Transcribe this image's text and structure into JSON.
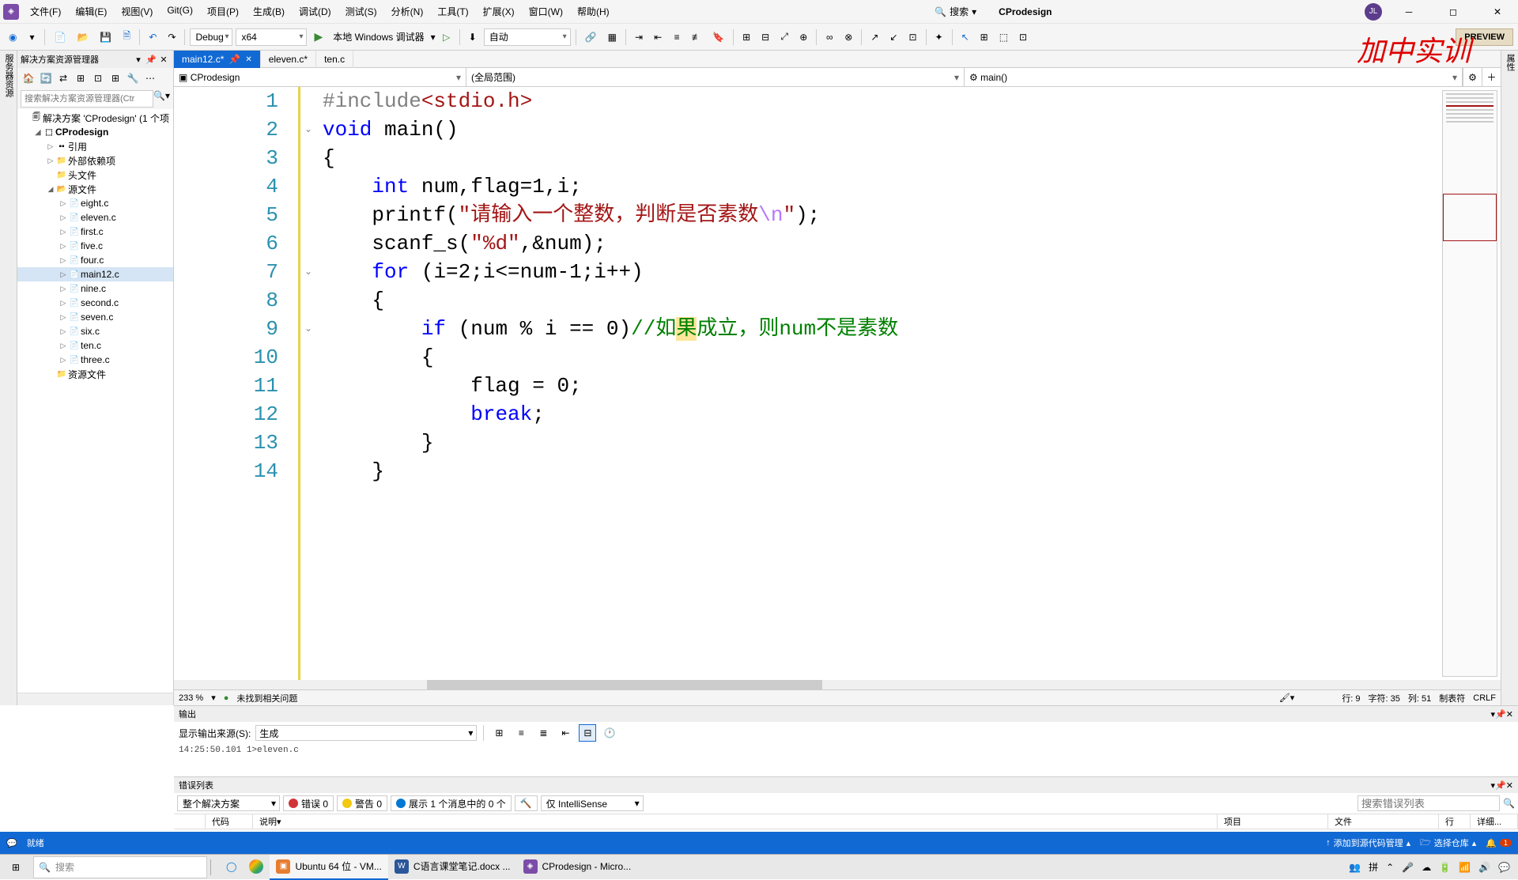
{
  "titlebar": {
    "menus": [
      "文件(F)",
      "编辑(E)",
      "视图(V)",
      "Git(G)",
      "项目(P)",
      "生成(B)",
      "调试(D)",
      "测试(S)",
      "分析(N)",
      "工具(T)",
      "扩展(X)",
      "窗口(W)",
      "帮助(H)"
    ],
    "search_label": "搜索",
    "app_title": "CProdesign",
    "user_initials": "JL"
  },
  "toolbar": {
    "config": "Debug",
    "platform": "x64",
    "debugger": "本地 Windows 调试器",
    "step_mode": "自动",
    "preview": "PREVIEW"
  },
  "watermark": "加中实训",
  "solution": {
    "title": "解决方案资源管理器",
    "search_placeholder": "搜索解决方案资源管理器(Ctr",
    "root": "解决方案 'CProdesign' (1 个项",
    "project": "CProdesign",
    "refs": "引用",
    "ext_deps": "外部依赖项",
    "headers": "头文件",
    "sources": "源文件",
    "resources": "资源文件",
    "files": [
      "eight.c",
      "eleven.c",
      "first.c",
      "five.c",
      "four.c",
      "main12.c",
      "nine.c",
      "second.c",
      "seven.c",
      "six.c",
      "ten.c",
      "three.c"
    ]
  },
  "tabs": [
    {
      "label": "main12.c*",
      "active": true,
      "pinned": true
    },
    {
      "label": "eleven.c*",
      "active": false
    },
    {
      "label": "ten.c",
      "active": false
    }
  ],
  "nav": {
    "left_icon": "▣",
    "left": "CProdesign",
    "mid": "(全局范围)",
    "right_icon": "⚙",
    "right": "main()"
  },
  "code": {
    "lines": [
      {
        "n": 1,
        "text": "#include<stdio.h>"
      },
      {
        "n": 2,
        "text": "void main()"
      },
      {
        "n": 3,
        "text": "{"
      },
      {
        "n": 4,
        "text": "    int num,flag=1,i;"
      },
      {
        "n": 5,
        "text": "    printf(\"请输入一个整数，判断是否素数\\n\");"
      },
      {
        "n": 6,
        "text": "    scanf_s(\"%d\",&num);"
      },
      {
        "n": 7,
        "text": "    for (i=2;i<=num-1;i++)"
      },
      {
        "n": 8,
        "text": "    {"
      },
      {
        "n": 9,
        "text": "        if (num % i == 0)//如果成立，则num不是素数"
      },
      {
        "n": 10,
        "text": "        {"
      },
      {
        "n": 11,
        "text": "            flag = 0;"
      },
      {
        "n": 12,
        "text": "            break;"
      },
      {
        "n": 13,
        "text": "        }"
      },
      {
        "n": 14,
        "text": "    }"
      }
    ]
  },
  "code_status": {
    "zoom": "233 %",
    "issues": "未找到相关问题",
    "line": "行: 9",
    "chars": "字符: 35",
    "col": "列: 51",
    "tabs": "制表符",
    "eol": "CRLF"
  },
  "output": {
    "title": "输出",
    "source_label": "显示输出来源(S):",
    "source_value": "生成",
    "body": "14:25:50.101   1>eleven.c"
  },
  "errors": {
    "title": "错误列表",
    "scope": "整个解决方案",
    "err_label": "错误 0",
    "warn_label": "警告 0",
    "msg_label": "展示 1 个消息中的 0 个",
    "intellisense": "仅 IntelliSense",
    "search_placeholder": "搜索错误列表",
    "cols": [
      "",
      "代码",
      "说明",
      "项目",
      "文件",
      "行",
      "详细..."
    ]
  },
  "statusbar": {
    "ready": "就绪",
    "add_scm": "添加到源代码管理",
    "select_repo": "选择仓库",
    "notif_count": "1"
  },
  "taskbar": {
    "search_placeholder": "搜索",
    "apps": [
      {
        "label": "Ubuntu 64 位 - VM...",
        "color": "#e77d2e"
      },
      {
        "label": "C语言课堂笔记.docx ...",
        "color": "#2b579a"
      },
      {
        "label": "CProdesign - Micro...",
        "color": "#7b4ca8"
      }
    ]
  }
}
